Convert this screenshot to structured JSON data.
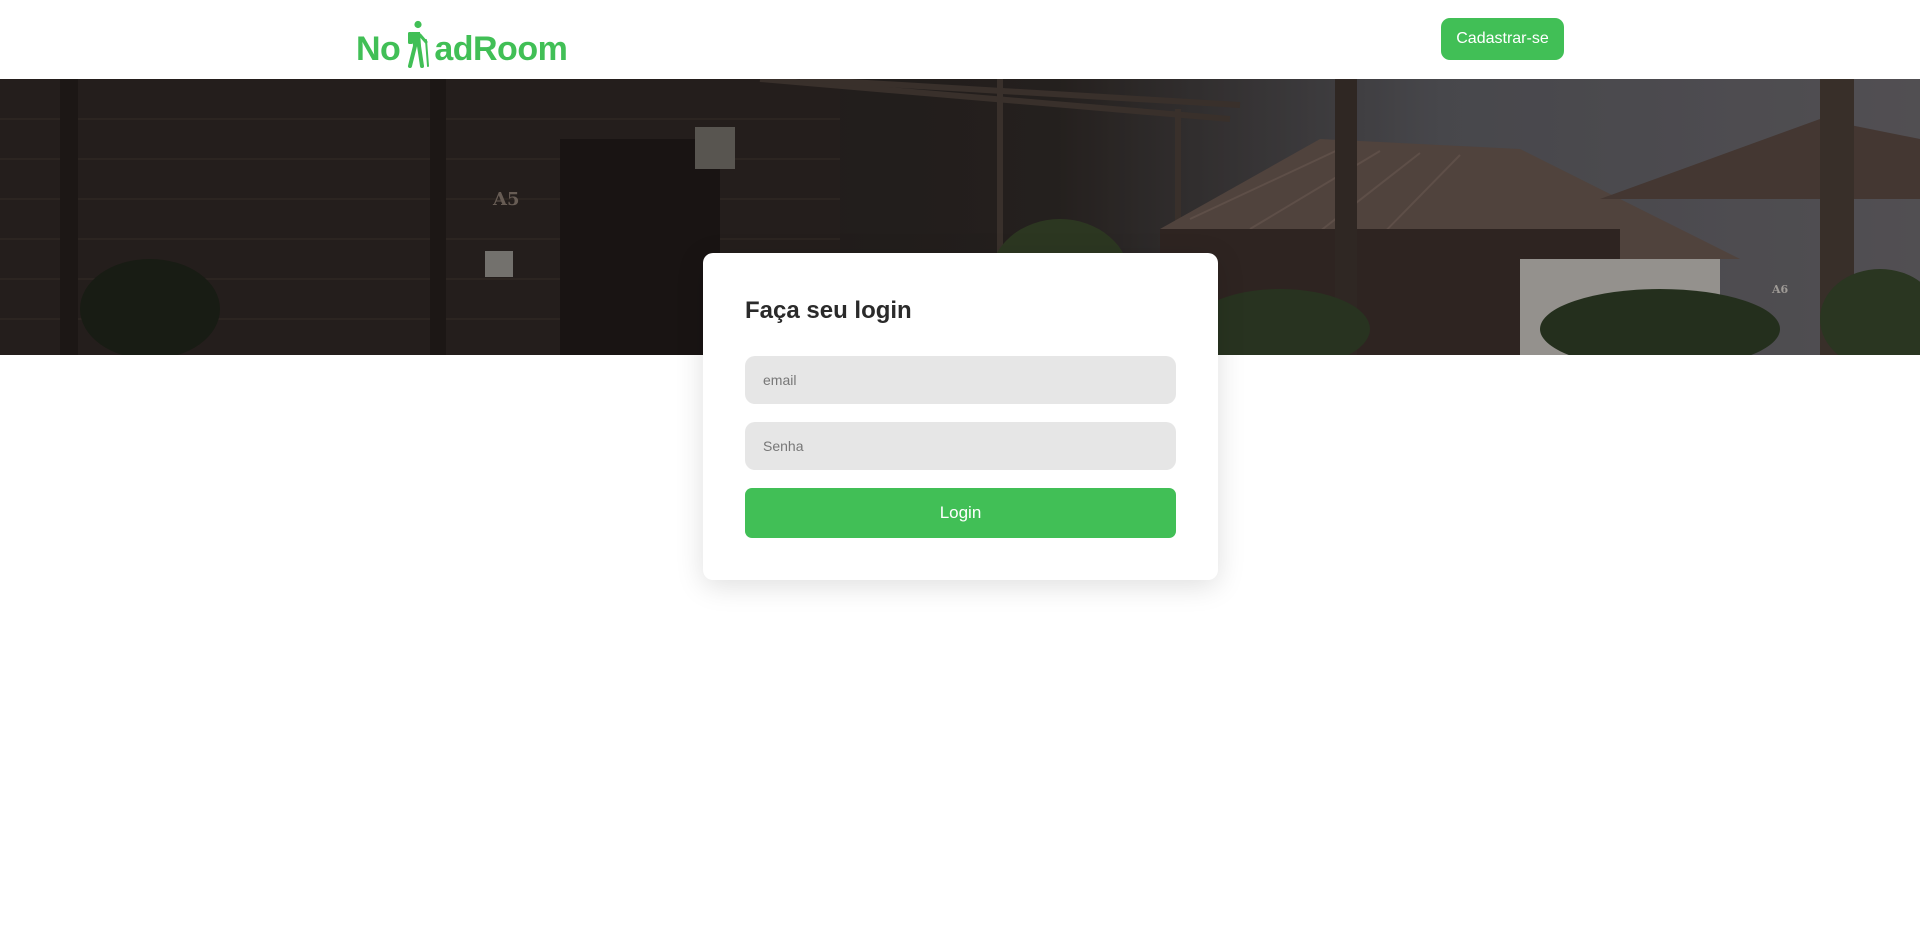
{
  "header": {
    "logo": {
      "text_before": "No",
      "text_after": "adRoom",
      "icon": "hiker-icon",
      "color": "#41bf56"
    },
    "signup_label": "Cadastrar-se"
  },
  "hero": {
    "image": "wooden-cabins-photo"
  },
  "login": {
    "title": "Faça seu login",
    "email_placeholder": "email",
    "password_placeholder": "Senha",
    "submit_label": "Login"
  },
  "colors": {
    "accent": "#41bf56",
    "input_bg": "#e6e6e6",
    "title_text": "#2a2a2a"
  }
}
